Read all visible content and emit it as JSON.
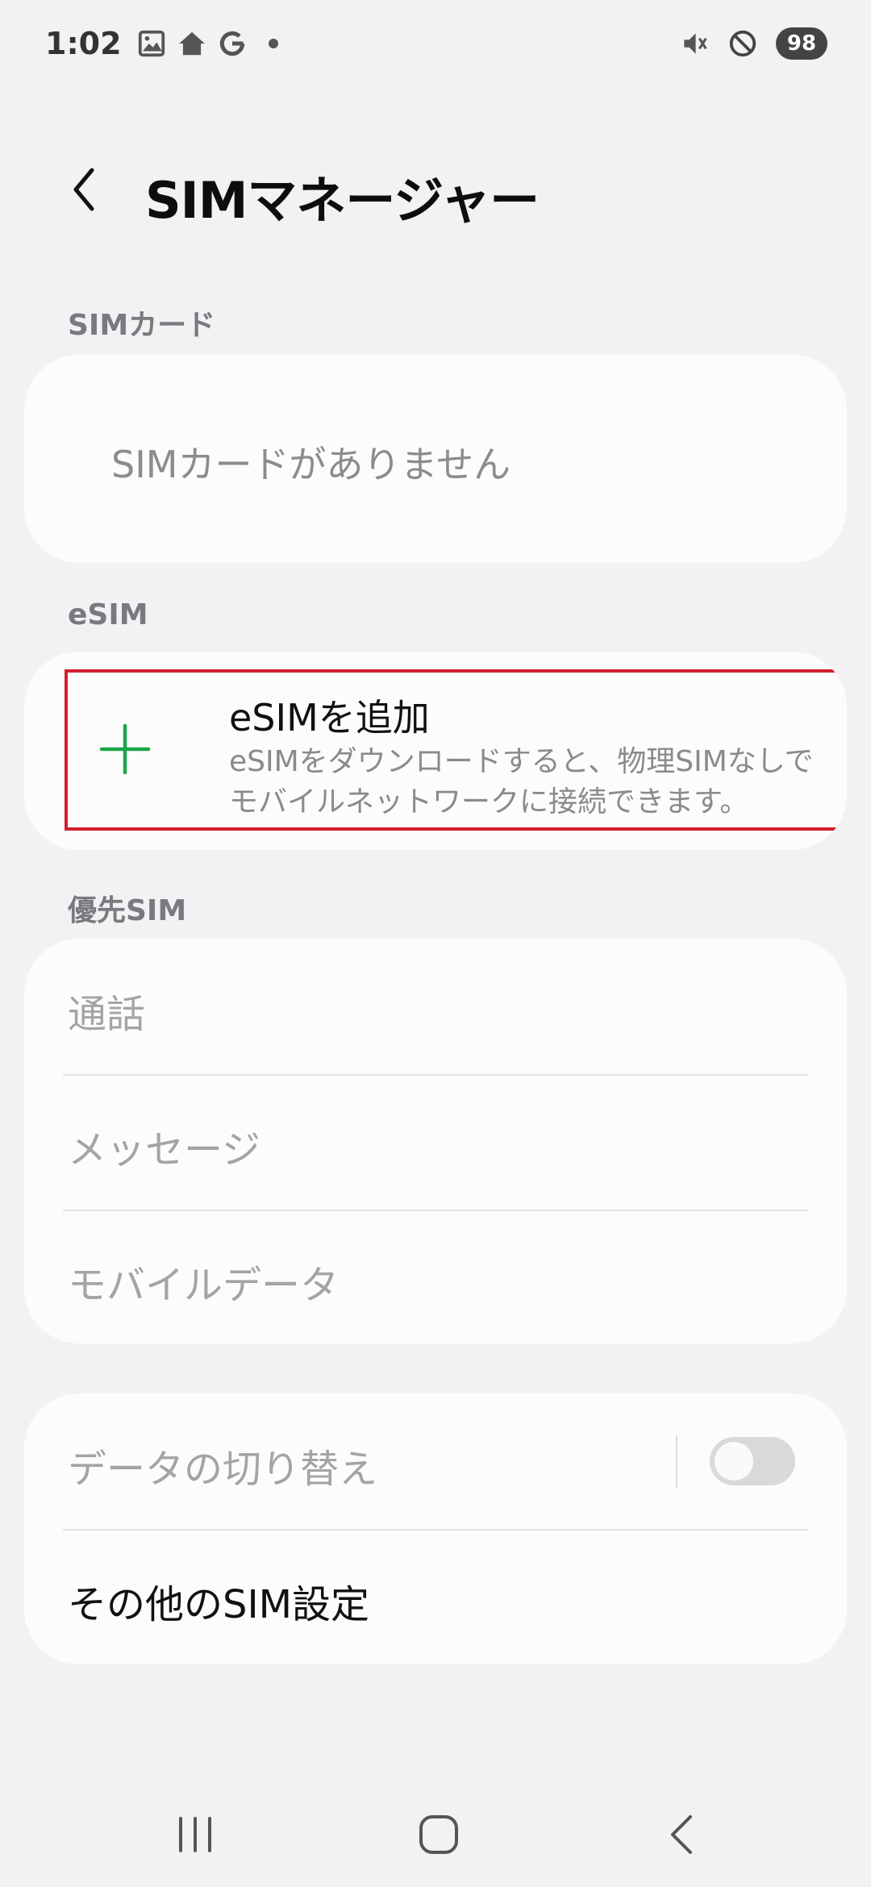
{
  "status_bar": {
    "time": "1:02",
    "left_icons": [
      "image-icon",
      "home-icon",
      "google-g-icon"
    ],
    "right_icons": [
      "mute-icon",
      "do-not-disturb-icon"
    ],
    "battery": "98"
  },
  "header": {
    "title": "SIMマネージャー",
    "back_icon": "chevron-left-icon"
  },
  "sim_card": {
    "section_label": "SIMカード",
    "empty_text": "SIMカードがありません"
  },
  "esim": {
    "section_label": "eSIM",
    "add_title": "eSIMを追加",
    "add_description": "eSIMをダウンロードすると、物理SIMなしでモバイルネットワークに接続できます。",
    "accent_color": "#1aa64a"
  },
  "preferred_sim": {
    "section_label": "優先SIM",
    "rows": [
      "通話",
      "メッセージ",
      "モバイルデータ"
    ]
  },
  "settings": {
    "data_switch_label": "データの切り替え",
    "data_switch_on": false,
    "more_settings_label": "その他のSIM設定"
  },
  "nav_bar": {
    "icons": [
      "recent-apps-icon",
      "home-button-icon",
      "back-icon"
    ]
  }
}
